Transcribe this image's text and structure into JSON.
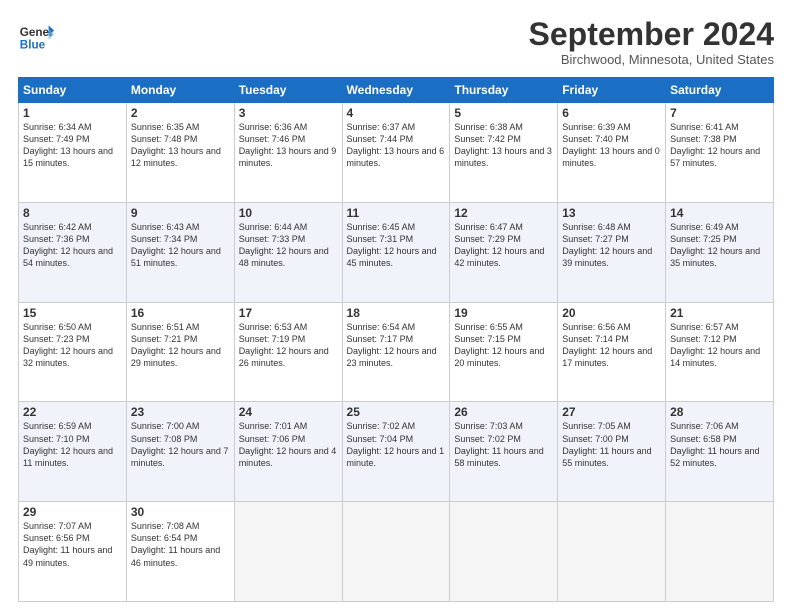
{
  "header": {
    "logo_line1": "General",
    "logo_line2": "Blue",
    "month": "September 2024",
    "location": "Birchwood, Minnesota, United States"
  },
  "weekdays": [
    "Sunday",
    "Monday",
    "Tuesday",
    "Wednesday",
    "Thursday",
    "Friday",
    "Saturday"
  ],
  "weeks": [
    [
      {
        "day": "1",
        "sunrise": "6:34 AM",
        "sunset": "7:49 PM",
        "daylight": "13 hours and 15 minutes."
      },
      {
        "day": "2",
        "sunrise": "6:35 AM",
        "sunset": "7:48 PM",
        "daylight": "13 hours and 12 minutes."
      },
      {
        "day": "3",
        "sunrise": "6:36 AM",
        "sunset": "7:46 PM",
        "daylight": "13 hours and 9 minutes."
      },
      {
        "day": "4",
        "sunrise": "6:37 AM",
        "sunset": "7:44 PM",
        "daylight": "13 hours and 6 minutes."
      },
      {
        "day": "5",
        "sunrise": "6:38 AM",
        "sunset": "7:42 PM",
        "daylight": "13 hours and 3 minutes."
      },
      {
        "day": "6",
        "sunrise": "6:39 AM",
        "sunset": "7:40 PM",
        "daylight": "13 hours and 0 minutes."
      },
      {
        "day": "7",
        "sunrise": "6:41 AM",
        "sunset": "7:38 PM",
        "daylight": "12 hours and 57 minutes."
      }
    ],
    [
      {
        "day": "8",
        "sunrise": "6:42 AM",
        "sunset": "7:36 PM",
        "daylight": "12 hours and 54 minutes."
      },
      {
        "day": "9",
        "sunrise": "6:43 AM",
        "sunset": "7:34 PM",
        "daylight": "12 hours and 51 minutes."
      },
      {
        "day": "10",
        "sunrise": "6:44 AM",
        "sunset": "7:33 PM",
        "daylight": "12 hours and 48 minutes."
      },
      {
        "day": "11",
        "sunrise": "6:45 AM",
        "sunset": "7:31 PM",
        "daylight": "12 hours and 45 minutes."
      },
      {
        "day": "12",
        "sunrise": "6:47 AM",
        "sunset": "7:29 PM",
        "daylight": "12 hours and 42 minutes."
      },
      {
        "day": "13",
        "sunrise": "6:48 AM",
        "sunset": "7:27 PM",
        "daylight": "12 hours and 39 minutes."
      },
      {
        "day": "14",
        "sunrise": "6:49 AM",
        "sunset": "7:25 PM",
        "daylight": "12 hours and 35 minutes."
      }
    ],
    [
      {
        "day": "15",
        "sunrise": "6:50 AM",
        "sunset": "7:23 PM",
        "daylight": "12 hours and 32 minutes."
      },
      {
        "day": "16",
        "sunrise": "6:51 AM",
        "sunset": "7:21 PM",
        "daylight": "12 hours and 29 minutes."
      },
      {
        "day": "17",
        "sunrise": "6:53 AM",
        "sunset": "7:19 PM",
        "daylight": "12 hours and 26 minutes."
      },
      {
        "day": "18",
        "sunrise": "6:54 AM",
        "sunset": "7:17 PM",
        "daylight": "12 hours and 23 minutes."
      },
      {
        "day": "19",
        "sunrise": "6:55 AM",
        "sunset": "7:15 PM",
        "daylight": "12 hours and 20 minutes."
      },
      {
        "day": "20",
        "sunrise": "6:56 AM",
        "sunset": "7:14 PM",
        "daylight": "12 hours and 17 minutes."
      },
      {
        "day": "21",
        "sunrise": "6:57 AM",
        "sunset": "7:12 PM",
        "daylight": "12 hours and 14 minutes."
      }
    ],
    [
      {
        "day": "22",
        "sunrise": "6:59 AM",
        "sunset": "7:10 PM",
        "daylight": "12 hours and 11 minutes."
      },
      {
        "day": "23",
        "sunrise": "7:00 AM",
        "sunset": "7:08 PM",
        "daylight": "12 hours and 7 minutes."
      },
      {
        "day": "24",
        "sunrise": "7:01 AM",
        "sunset": "7:06 PM",
        "daylight": "12 hours and 4 minutes."
      },
      {
        "day": "25",
        "sunrise": "7:02 AM",
        "sunset": "7:04 PM",
        "daylight": "12 hours and 1 minute."
      },
      {
        "day": "26",
        "sunrise": "7:03 AM",
        "sunset": "7:02 PM",
        "daylight": "11 hours and 58 minutes."
      },
      {
        "day": "27",
        "sunrise": "7:05 AM",
        "sunset": "7:00 PM",
        "daylight": "11 hours and 55 minutes."
      },
      {
        "day": "28",
        "sunrise": "7:06 AM",
        "sunset": "6:58 PM",
        "daylight": "11 hours and 52 minutes."
      }
    ],
    [
      {
        "day": "29",
        "sunrise": "7:07 AM",
        "sunset": "6:56 PM",
        "daylight": "11 hours and 49 minutes."
      },
      {
        "day": "30",
        "sunrise": "7:08 AM",
        "sunset": "6:54 PM",
        "daylight": "11 hours and 46 minutes."
      },
      null,
      null,
      null,
      null,
      null
    ]
  ]
}
